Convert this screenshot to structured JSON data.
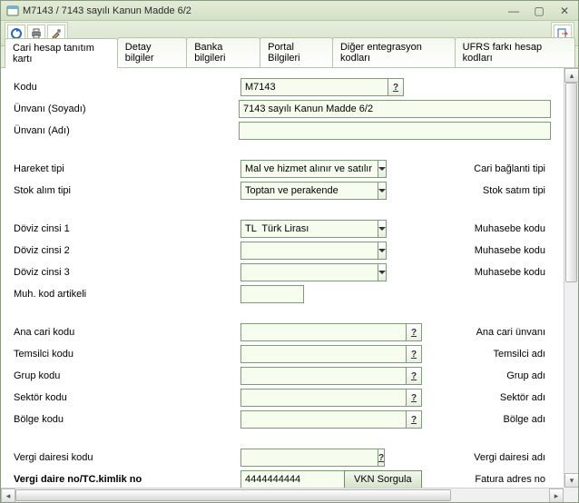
{
  "window": {
    "title": "M7143 / 7143 sayılı Kanun Madde 6/2"
  },
  "tabs": [
    {
      "label": "Cari hesap tanıtım kartı",
      "active": true
    },
    {
      "label": "Detay bilgiler",
      "active": false
    },
    {
      "label": "Banka bilgileri",
      "active": false
    },
    {
      "label": "Portal Bilgileri",
      "active": false
    },
    {
      "label": "Diğer entegrasyon kodları",
      "active": false
    },
    {
      "label": "UFRS farkı hesap kodları",
      "active": false
    }
  ],
  "fields": {
    "kodu": {
      "label": "Kodu",
      "value": "M7143"
    },
    "unvani_soyadi": {
      "label": "Ünvanı (Soyadı)",
      "value": "7143 sayılı Kanun Madde 6/2"
    },
    "unvani_adi": {
      "label": "Ünvanı (Adı)",
      "value": ""
    },
    "hareket_tipi": {
      "label": "Hareket tipi",
      "value": "Mal ve hizmet alınır ve satılır",
      "right": "Cari bağlanti tipi"
    },
    "stok_alim_tipi": {
      "label": "Stok alım tipi",
      "value": "Toptan ve perakende",
      "right": "Stok satım tipi"
    },
    "doviz1": {
      "label": "Döviz cinsi 1",
      "value": "TL  Türk Lirası",
      "right": "Muhasebe kodu"
    },
    "doviz2": {
      "label": "Döviz cinsi 2",
      "value": "",
      "right": "Muhasebe kodu"
    },
    "doviz3": {
      "label": "Döviz cinsi 3",
      "value": "",
      "right": "Muhasebe kodu"
    },
    "muh_kod_artikeli": {
      "label": "Muh. kod artikeli",
      "value": ""
    },
    "ana_cari_kodu": {
      "label": "Ana cari kodu",
      "value": "",
      "right": "Ana cari ünvanı"
    },
    "temsilci_kodu": {
      "label": "Temsilci kodu",
      "value": "",
      "right": "Temsilci adı"
    },
    "grup_kodu": {
      "label": "Grup kodu",
      "value": "",
      "right": "Grup adı"
    },
    "sektor_kodu": {
      "label": "Sektör kodu",
      "value": "",
      "right": "Sektör adı"
    },
    "bolge_kodu": {
      "label": "Bölge kodu",
      "value": "",
      "right": "Bölge adı"
    },
    "vergi_dairesi_kodu": {
      "label": "Vergi dairesi kodu",
      "value": "",
      "right": "Vergi dairesi adı"
    },
    "vergi_daire_no": {
      "label": "Vergi daire no/TC.kimlik no",
      "value": "4444444444",
      "right": "Fatura adres no",
      "btn": "VKN Sorgula"
    }
  },
  "colors": {
    "input_bg": "#f6fdee",
    "input_border": "#7e9b79"
  }
}
